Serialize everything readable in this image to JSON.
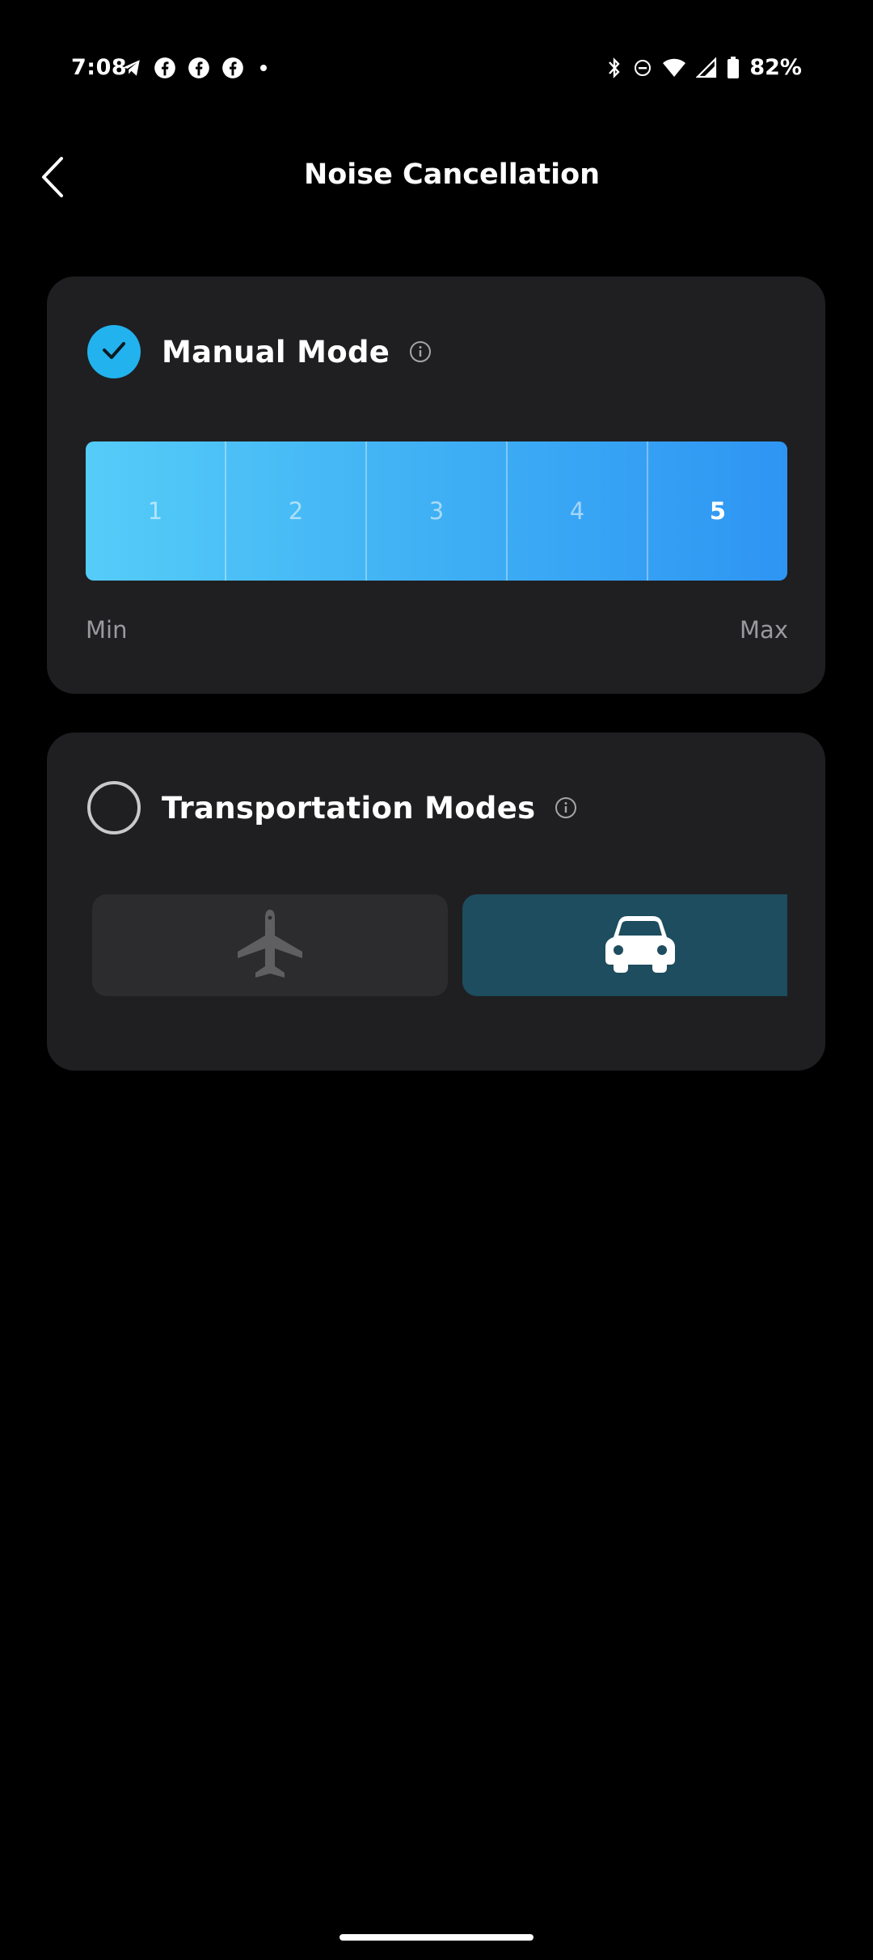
{
  "status_bar": {
    "time": "7:08",
    "battery_text": "82%",
    "icons_left": [
      "telegram-icon",
      "facebook-icon",
      "facebook-icon",
      "facebook-icon",
      "dot-icon"
    ],
    "icons_right": [
      "bluetooth-icon",
      "do-not-disturb-icon",
      "wifi-icon",
      "cellular-signal-icon",
      "battery-icon"
    ]
  },
  "header": {
    "title": "Noise Cancellation",
    "back_icon": "chevron-left-icon"
  },
  "manual_mode": {
    "title": "Manual Mode",
    "selected": true,
    "info_icon": "info-icon",
    "levels": [
      "1",
      "2",
      "3",
      "4",
      "5"
    ],
    "active_level": "5",
    "min_label": "Min",
    "max_label": "Max"
  },
  "transportation_modes": {
    "title": "Transportation Modes",
    "selected": false,
    "info_icon": "info-icon",
    "options": [
      {
        "icon": "airplane-icon",
        "active": false
      },
      {
        "icon": "car-icon",
        "active": true
      }
    ]
  },
  "colors": {
    "background": "#000000",
    "card": "#1f1f21",
    "accent": "#22b2ee",
    "level_gradient_start": "#55ccf8",
    "level_gradient_end": "#2e95f3",
    "active_tile": "#1d4d5e",
    "inactive_tile": "#2c2c2e"
  }
}
